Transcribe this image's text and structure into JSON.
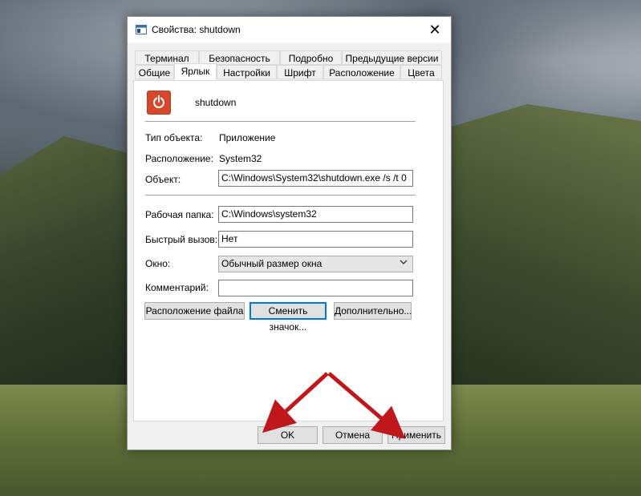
{
  "window": {
    "title": "Свойства: shutdown",
    "close_glyph": "✕"
  },
  "tabs_top": [
    "Терминал",
    "Безопасность",
    "Подробно",
    "Предыдущие версии"
  ],
  "tabs_bottom": [
    "Общие",
    "Ярлык",
    "Настройки",
    "Шрифт",
    "Расположение",
    "Цвета"
  ],
  "active_tab": "Ярлык",
  "app": {
    "name": "shutdown",
    "icon": "power-icon",
    "icon_color": "#d8472b"
  },
  "info": {
    "type_label": "Тип объекта:",
    "type_value": "Приложение",
    "location_label": "Расположение:",
    "location_value": "System32",
    "target_label": "Объект:",
    "target_value": "C:\\Windows\\System32\\shutdown.exe /s /t 0"
  },
  "form": {
    "workdir_label": "Рабочая папка:",
    "workdir_value": "C:\\Windows\\system32",
    "hotkey_label": "Быстрый вызов:",
    "hotkey_value": "Нет",
    "window_label": "Окно:",
    "window_value": "Обычный размер окна",
    "comment_label": "Комментарий:",
    "comment_value": ""
  },
  "actions": {
    "open_location": "Расположение файла",
    "change_icon": "Сменить значок...",
    "advanced": "Дополнительно..."
  },
  "footer": {
    "ok": "OK",
    "cancel": "Отмена",
    "apply": "Применить"
  },
  "annotation": {
    "arrow_color": "#c0171b"
  }
}
